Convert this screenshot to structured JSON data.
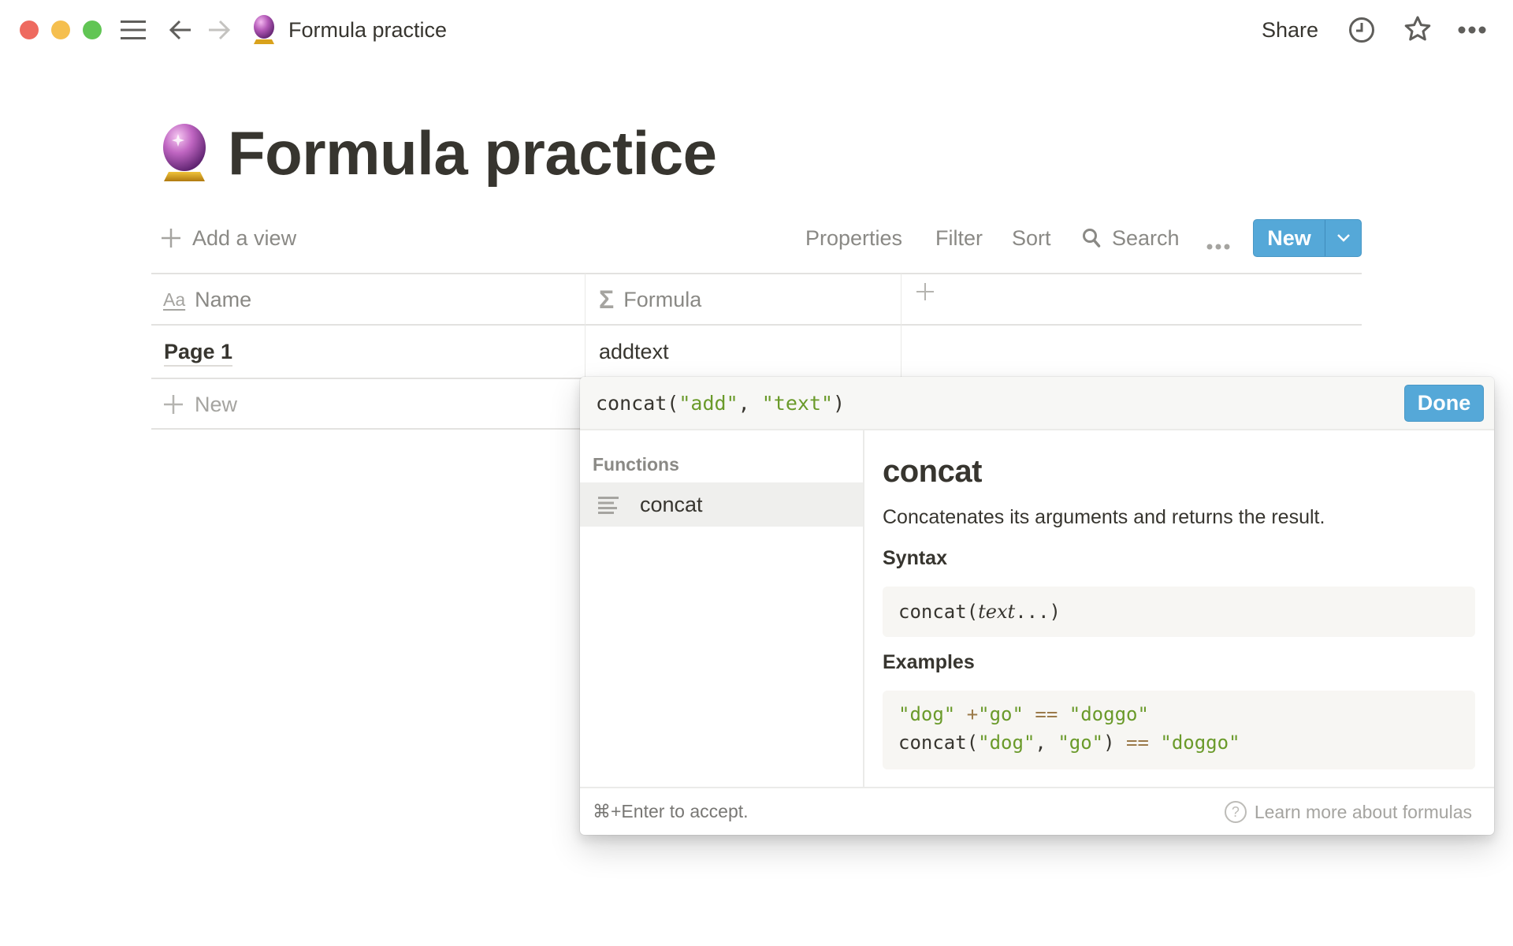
{
  "topbar": {
    "breadcrumb_title": "Formula practice",
    "share_label": "Share",
    "icons": [
      "sidebar-menu-icon",
      "back-arrow-icon",
      "forward-arrow-icon",
      "crystal-ball-icon",
      "history-clock-icon",
      "favorite-star-icon",
      "more-options-icon"
    ]
  },
  "page": {
    "title": "Formula practice",
    "icon": "crystal-ball"
  },
  "viewbar": {
    "add_view": "Add a view",
    "properties": "Properties",
    "filter": "Filter",
    "sort": "Sort",
    "search": "Search",
    "new_label": "New"
  },
  "table": {
    "columns": [
      {
        "icon": "Aa",
        "label": "Name"
      },
      {
        "icon": "Σ",
        "label": "Formula"
      }
    ],
    "add_column": "+",
    "rows": [
      {
        "name": "Page 1",
        "formula": "addtext"
      }
    ],
    "new_row_label": "New"
  },
  "formula_editor": {
    "input_tokens": {
      "fn": "concat(",
      "arg1": "\"add\"",
      "sep": ", ",
      "arg2": "\"text\"",
      "close": ")"
    },
    "done_label": "Done",
    "functions_header": "Functions",
    "functions": [
      {
        "name": "concat",
        "selected": true
      }
    ],
    "detail": {
      "title": "concat",
      "description": "Concatenates its arguments and returns the result.",
      "syntax_heading": "Syntax",
      "syntax_fn": "concat(",
      "syntax_arg": "text",
      "syntax_rest": "...)",
      "examples_heading": "Examples",
      "example1": {
        "a": "\"dog\"",
        "op1": "+",
        "b": "\"go\"",
        "op2": "==",
        "c": "\"doggo\""
      },
      "example2": {
        "fn": "concat(",
        "a": "\"dog\"",
        "sep": ", ",
        "b": "\"go\"",
        "close": ")",
        "op": "==",
        "c": "\"doggo\""
      }
    },
    "footer_hint": "⌘+Enter to accept.",
    "learn_more": "Learn more about formulas"
  },
  "colors": {
    "accent_blue": "#55a8d8",
    "string_green": "#6a9a2a",
    "operator_brown": "#9b7a4a"
  }
}
